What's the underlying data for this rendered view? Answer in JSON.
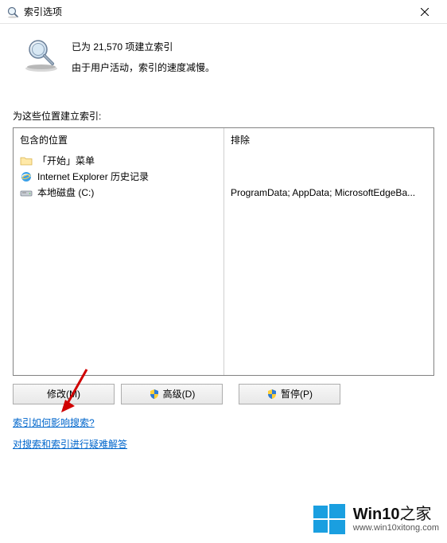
{
  "titlebar": {
    "title": "索引选项"
  },
  "status": {
    "line1": "已为 21,570 项建立索引",
    "line2": "由于用户活动，索引的速度减慢。"
  },
  "section_label": "为这些位置建立索引:",
  "list": {
    "included_header": "包含的位置",
    "excluded_header": "排除",
    "items": [
      {
        "label": "「开始」菜单",
        "icon": "folder-icon",
        "exclude": ""
      },
      {
        "label": "Internet Explorer 历史记录",
        "icon": "ie-icon",
        "exclude": ""
      },
      {
        "label": "本地磁盘 (C:)",
        "icon": "drive-icon",
        "exclude": "ProgramData; AppData; MicrosoftEdgeBa..."
      }
    ]
  },
  "buttons": {
    "modify": "修改(M)",
    "advanced": "高级(D)",
    "pause": "暂停(P)"
  },
  "links": {
    "how_affect": "索引如何影响搜索?",
    "troubleshoot": "对搜索和索引进行疑难解答"
  },
  "watermark": {
    "brand": "Win10",
    "suffix": "之家",
    "url": "www.win10xitong.com"
  }
}
